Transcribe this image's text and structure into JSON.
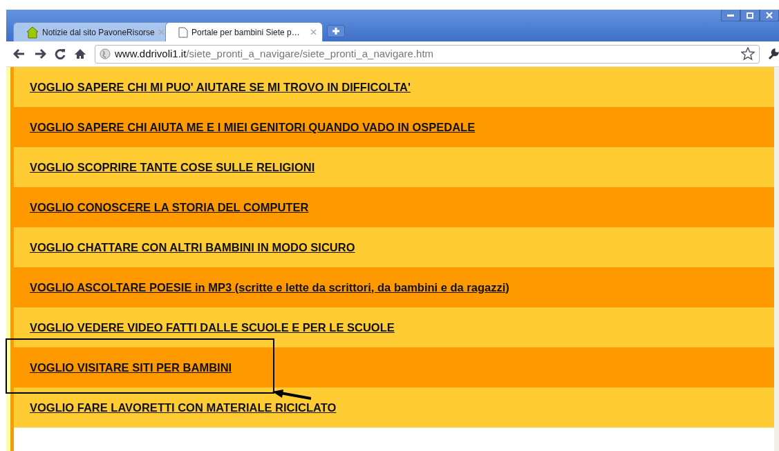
{
  "tabs": [
    {
      "label": "Notizie dal sito PavoneRisorse",
      "selected": false
    },
    {
      "label": "Portale per bambini Siete p…",
      "selected": true
    }
  ],
  "address": {
    "host": "www.ddrivoli1.it",
    "path": "/siete_pronti_a_navigare/siete_pronti_a_navigare.htm"
  },
  "links": [
    {
      "text": "VOGLIO SAPERE CHI MI PUO' AIUTARE SE MI TROVO IN DIFFICOLTA'",
      "color": "#ffcc33"
    },
    {
      "text": "VOGLIO SAPERE CHI AIUTA ME E I MIEI GENITORI QUANDO VADO IN OSPEDALE",
      "color": "#ff9900"
    },
    {
      "text": "VOGLIO SCOPRIRE TANTE COSE SULLE RELIGIONI",
      "color": "#ffcc33"
    },
    {
      "text": "VOGLIO CONOSCERE LA STORIA DEL COMPUTER",
      "color": "#ff9900"
    },
    {
      "text": "VOGLIO CHATTARE CON ALTRI BAMBINI IN MODO SICURO",
      "color": "#ffcc33"
    },
    {
      "text": "VOGLIO ASCOLTARE POESIE in MP3 (scritte e lette da scrittori, da bambini e da ragazzi)",
      "color": "#ff9900"
    },
    {
      "text": "VOGLIO VEDERE VIDEO FATTI DALLE SCUOLE E PER LE SCUOLE",
      "color": "#ffcc33"
    },
    {
      "text": "VOGLIO VISITARE SITI PER BAMBINI",
      "color": "#ff9900"
    },
    {
      "text": "VOGLIO FARE LAVORETTI CON MATERIALE RICICLATO",
      "color": "#ffcc33"
    }
  ]
}
